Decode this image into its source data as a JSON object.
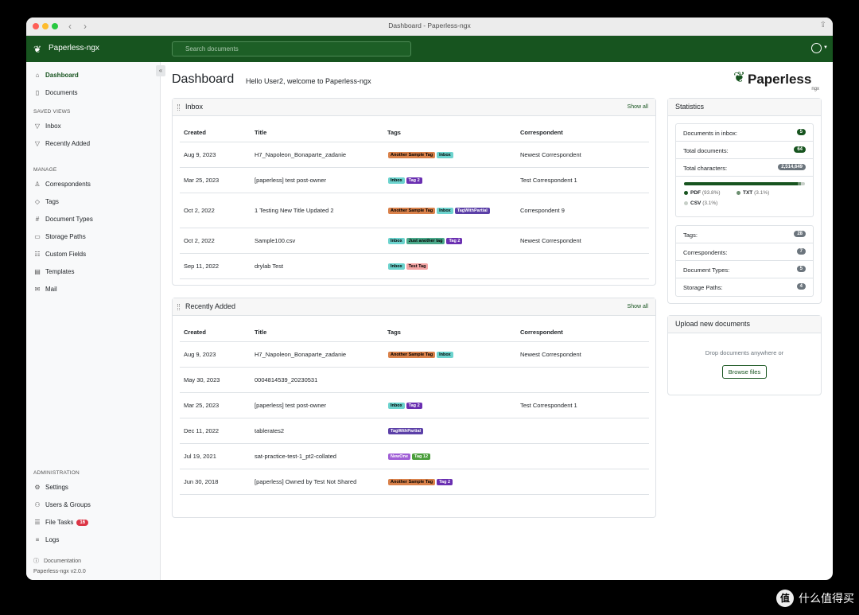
{
  "window": {
    "title": "Dashboard - Paperless-ngx"
  },
  "navbar": {
    "brand": "Paperless-ngx",
    "search_placeholder": "Search documents"
  },
  "sidebar": {
    "items": [
      {
        "label": "Dashboard",
        "icon": "house-icon",
        "active": true
      },
      {
        "label": "Documents",
        "icon": "file-icon"
      }
    ],
    "saved_views_heading": "SAVED VIEWS",
    "saved_views": [
      {
        "label": "Inbox",
        "icon": "funnel-icon"
      },
      {
        "label": "Recently Added",
        "icon": "funnel-icon"
      }
    ],
    "manage_heading": "MANAGE",
    "manage": [
      {
        "label": "Correspondents",
        "icon": "person-icon"
      },
      {
        "label": "Tags",
        "icon": "tag-icon"
      },
      {
        "label": "Document Types",
        "icon": "hash-icon"
      },
      {
        "label": "Storage Paths",
        "icon": "folder-icon"
      },
      {
        "label": "Custom Fields",
        "icon": "ui-radios-icon"
      },
      {
        "label": "Templates",
        "icon": "file-text-icon"
      },
      {
        "label": "Mail",
        "icon": "envelope-icon"
      }
    ],
    "admin_heading": "ADMINISTRATION",
    "admin": [
      {
        "label": "Settings",
        "icon": "gear-icon"
      },
      {
        "label": "Users & Groups",
        "icon": "people-icon"
      },
      {
        "label": "File Tasks",
        "icon": "list-task-icon",
        "badge": "16"
      },
      {
        "label": "Logs",
        "icon": "text-left-icon"
      }
    ],
    "documentation": "Documentation",
    "version": "Paperless-ngx v2.0.0"
  },
  "main": {
    "title": "Dashboard",
    "welcome": "Hello User2, welcome to Paperless-ngx",
    "logo_text": "Paperless",
    "logo_sub": "ngx"
  },
  "inbox": {
    "title": "Inbox",
    "show_all": "Show all",
    "columns": [
      "Created",
      "Title",
      "Tags",
      "Correspondent"
    ],
    "rows": [
      {
        "created": "Aug 9, 2023",
        "title": "H7_Napoleon_Bonaparte_zadanie",
        "tags": [
          [
            "Another Sample Tag",
            "#d9814a"
          ],
          [
            "Inbox",
            "#6cd3ce"
          ]
        ],
        "correspondent": "Newest Correspondent"
      },
      {
        "created": "Mar 25, 2023",
        "title": "[paperless] test post-owner",
        "tags": [
          [
            "Inbox",
            "#6cd3ce"
          ],
          [
            "Tag 2",
            "#6a2fb1"
          ]
        ],
        "correspondent": "Test Correspondent 1"
      },
      {
        "created": "Oct 2, 2022",
        "title": "1 Testing New Title Updated 2",
        "tags": [
          [
            "Another Sample Tag",
            "#d9814a"
          ],
          [
            "Inbox",
            "#6cd3ce"
          ],
          [
            "TagWithPartial",
            "#5b3fa7"
          ]
        ],
        "correspondent": "Correspondent 9"
      },
      {
        "created": "Oct 2, 2022",
        "title": "Sample100.csv",
        "tags": [
          [
            "Inbox",
            "#6cd3ce"
          ],
          [
            "Just another tag",
            "#4aa88a"
          ],
          [
            "Tag 2",
            "#6a2fb1"
          ]
        ],
        "correspondent": "Newest Correspondent"
      },
      {
        "created": "Sep 11, 2022",
        "title": "drylab Test",
        "tags": [
          [
            "Inbox",
            "#6cd3ce"
          ],
          [
            "Test Tag",
            "#f4a4a4"
          ]
        ],
        "correspondent": ""
      }
    ]
  },
  "recent": {
    "title": "Recently Added",
    "show_all": "Show all",
    "columns": [
      "Created",
      "Title",
      "Tags",
      "Correspondent"
    ],
    "rows": [
      {
        "created": "Aug 9, 2023",
        "title": "H7_Napoleon_Bonaparte_zadanie",
        "tags": [
          [
            "Another Sample Tag",
            "#d9814a"
          ],
          [
            "Inbox",
            "#6cd3ce"
          ]
        ],
        "correspondent": "Newest Correspondent"
      },
      {
        "created": "May 30, 2023",
        "title": "0004814539_20230531",
        "tags": [],
        "correspondent": ""
      },
      {
        "created": "Mar 25, 2023",
        "title": "[paperless] test post-owner",
        "tags": [
          [
            "Inbox",
            "#6cd3ce"
          ],
          [
            "Tag 2",
            "#6a2fb1"
          ]
        ],
        "correspondent": "Test Correspondent 1"
      },
      {
        "created": "Dec 11, 2022",
        "title": "tablerates2",
        "tags": [
          [
            "TagWithPartial",
            "#5b3fa7"
          ]
        ],
        "correspondent": ""
      },
      {
        "created": "Jul 19, 2021",
        "title": "sat-practice-test-1_pt2-collated",
        "tags": [
          [
            "NewOne",
            "#a05fd6"
          ],
          [
            "Tag 12",
            "#4b9e3c"
          ]
        ],
        "correspondent": ""
      },
      {
        "created": "Jun 30, 2018",
        "title": "[paperless] Owned by Test Not Shared",
        "tags": [
          [
            "Another Sample Tag",
            "#d9814a"
          ],
          [
            "Tag 2",
            "#6a2fb1"
          ]
        ],
        "correspondent": ""
      }
    ]
  },
  "statistics": {
    "title": "Statistics",
    "inbox_label": "Documents in inbox:",
    "inbox_value": "5",
    "total_docs_label": "Total documents:",
    "total_docs_value": "64",
    "total_chars_label": "Total characters:",
    "total_chars_value": "2,514,649",
    "file_types": [
      {
        "name": "PDF",
        "pct": "(93.8%)",
        "value": 93.8,
        "color": "#17541f"
      },
      {
        "name": "TXT",
        "pct": "(3.1%)",
        "value": 3.1,
        "color": "#6b8e6f"
      },
      {
        "name": "CSV",
        "pct": "(3.1%)",
        "value": 3.1,
        "color": "#c7cfc8"
      }
    ],
    "tags_label": "Tags:",
    "tags_value": "28",
    "correspondents_label": "Correspondents:",
    "correspondents_value": "7",
    "doctypes_label": "Document Types:",
    "doctypes_value": "5",
    "storage_label": "Storage Paths:",
    "storage_value": "4"
  },
  "upload": {
    "title": "Upload new documents",
    "drop_text": "Drop documents anywhere or",
    "browse_label": "Browse files"
  },
  "watermark": {
    "text": "什么值得买",
    "badge": "值"
  }
}
